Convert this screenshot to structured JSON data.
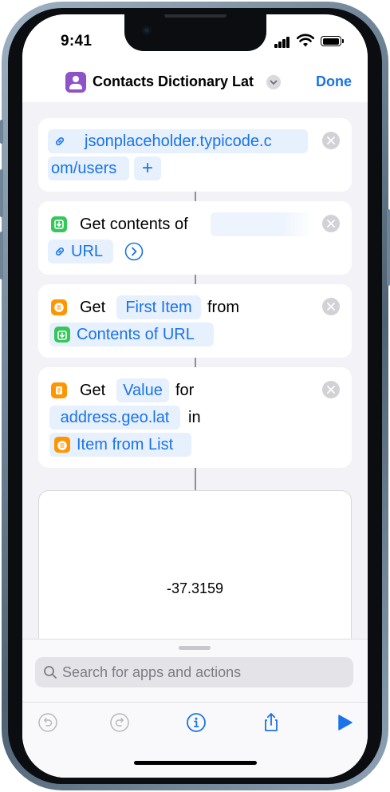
{
  "status": {
    "time": "9:41"
  },
  "navbar": {
    "title": "Contacts Dictionary Lat",
    "done_label": "Done",
    "app_icon": "contacts-icon",
    "accent": "#1a73e8"
  },
  "actions": {
    "url": {
      "text_line1": "jsonplaceholder.typicode.c",
      "text_line2": "om/users",
      "add_label": "+"
    },
    "get_contents": {
      "label": "Get contents of",
      "url_label": "URL"
    },
    "get_item": {
      "get_label": "Get",
      "item_label": "First Item",
      "from_label": "from",
      "source_label": "Contents of URL"
    },
    "get_value": {
      "get_label": "Get",
      "value_label": "Value",
      "for_label": "for",
      "key_label": "address.geo.lat",
      "in_label": "in",
      "source_label": "Item from List"
    }
  },
  "result": {
    "value": "-37.3159"
  },
  "sheet": {
    "search_placeholder": "Search for apps and actions"
  }
}
